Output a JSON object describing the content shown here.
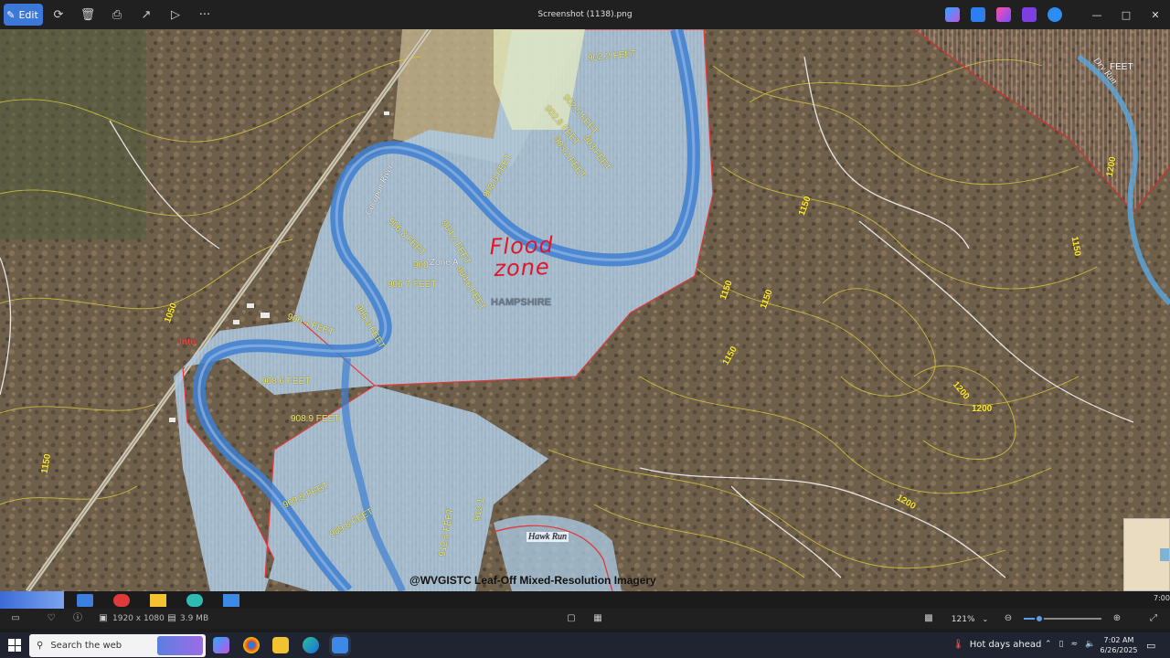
{
  "toolbar": {
    "edit_label": "Edit",
    "window_title": "Screenshot (1138).png",
    "more_label": "···"
  },
  "map": {
    "annotation_line1": "Flood",
    "annotation_line2": "zone",
    "watermark": "@WVGISTC Leaf-Off Mixed-Resolution Imagery",
    "labels": {
      "county": "HAMPSHIRE",
      "zone": "Zone A",
      "river": "Cacapon River",
      "creek": "Hawk Run",
      "dry_run": "Dry Run",
      "e902_2": "902.2 FEET",
      "e902_5": "902.5 FEET",
      "e902_8": "902.8 FEET",
      "e903_2": "903.2 FEET",
      "e903": "903 FEET",
      "e903_6": "903.6 FEET",
      "e904_2": "904.2 FEET",
      "e904_6": "904.6 FEET",
      "e905_9": "905.9 FEET",
      "e906_3": "906.3 FEET",
      "e906_4": "906.4 FEET",
      "e906_7": "906.7 FEET",
      "e908_6": "908.6 FEET",
      "e908_9": "908.9 FEET",
      "e909_5": "909.5 FEET",
      "e909_8": "909.8 FEET",
      "e912_5": "912.5 FEET",
      "e912_1": "912.1",
      "c1150a": "1150",
      "c1150b": "1150",
      "c1150c": "1150",
      "c1150d": "1150",
      "c1150e": "1150",
      "c1150f": "1150",
      "c1050": "1050",
      "c1200a": "1200",
      "c1200b": "1200",
      "c1200c": "1200",
      "c1200d": "1200",
      "c1200e": "1200",
      "feet": "FEET",
      "c900": "900",
      "inter": "Inte"
    }
  },
  "infobar": {
    "dimensions": "1920 x 1080",
    "filesize": "3.9 MB",
    "zoom": "121%",
    "zoom_fraction": 0.2
  },
  "taskbar": {
    "search_placeholder": "Search the web",
    "weather": "Hot days ahead",
    "time": "7:02 AM",
    "date": "6/26/2025",
    "strip_time": "7:00"
  },
  "colors": {
    "edit_button": "#3c78d8",
    "flood_zone": "#a9c7de",
    "river": "#3e7fd0",
    "contour": "#d7c93a",
    "annotation": "#e2162a"
  }
}
